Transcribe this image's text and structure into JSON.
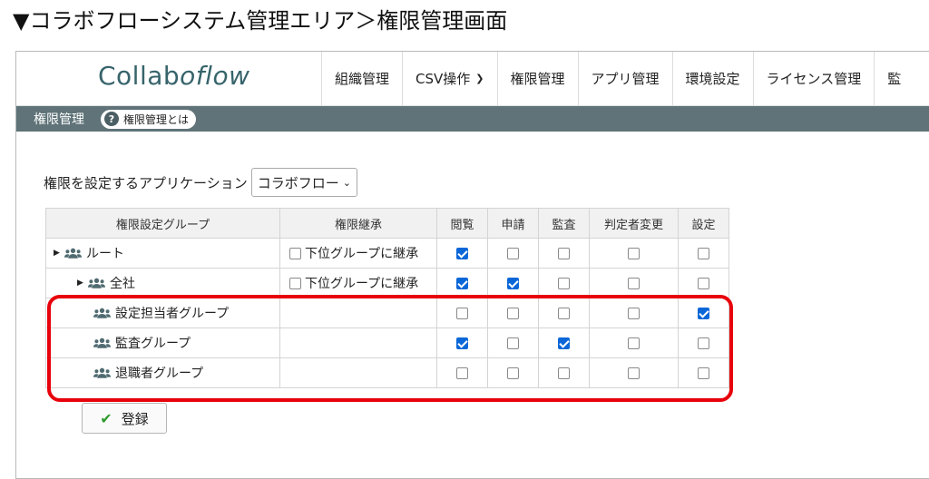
{
  "caption": "▼コラボフローシステム管理エリア＞権限管理画面",
  "header": {
    "logo_main": "Collab",
    "logo_flow": "oflow",
    "nav": [
      "組織管理",
      "CSV操作",
      "権限管理",
      "アプリ管理",
      "環境設定",
      "ライセンス管理",
      "監"
    ]
  },
  "subbar": {
    "title": "権限管理",
    "help": "権限管理とは"
  },
  "app_select": {
    "label": "権限を設定するアプリケーション",
    "value": "コラボフロー"
  },
  "table": {
    "headers": {
      "group": "権限設定グループ",
      "inherit": "権限継承",
      "view": "閲覧",
      "apply": "申請",
      "audit": "監査",
      "judge": "判定者変更",
      "settings": "設定"
    },
    "inherit_label": "下位グループに継承",
    "rows": [
      {
        "name": "ルート",
        "view": true,
        "apply": false,
        "audit": false,
        "judge": false,
        "settings": false
      },
      {
        "name": "全社",
        "view": true,
        "apply": true,
        "audit": false,
        "judge": false,
        "settings": false
      },
      {
        "name": "設定担当者グループ",
        "view": false,
        "apply": false,
        "audit": false,
        "judge": false,
        "settings": true
      },
      {
        "name": "監査グループ",
        "view": true,
        "apply": false,
        "audit": true,
        "judge": false,
        "settings": false
      },
      {
        "name": "退職者グループ",
        "view": false,
        "apply": false,
        "audit": false,
        "judge": false,
        "settings": false
      }
    ]
  },
  "submit_label": "登録",
  "colors": {
    "subbar": "#5f7378",
    "checkbox_on": "#0b67d8",
    "highlight": "#e8000b",
    "logo": "#37646b"
  },
  "icons": {
    "users": "users-icon",
    "help": "question-icon",
    "submit": "check-icon",
    "caret": "caret-right-icon",
    "dropdown": "chevron-down-icon"
  }
}
